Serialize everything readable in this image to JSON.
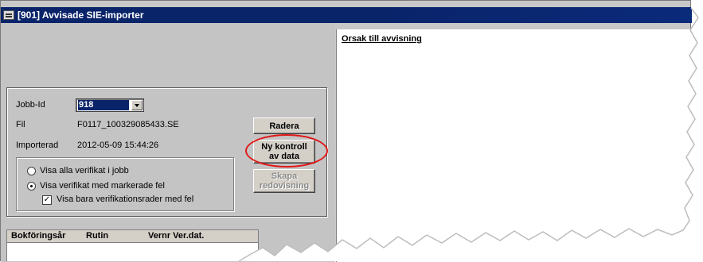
{
  "window": {
    "title": "[901]  Avvisade SIE-importer"
  },
  "form": {
    "jobb_id_label": "Jobb-Id",
    "jobb_id_value": "918",
    "fil_label": "Fil",
    "fil_value": "F0117_100329085433.SE",
    "importerad_label": "Importerad",
    "importerad_value": "2012-05-09 15:44:26"
  },
  "buttons": {
    "radera": "Radera",
    "ny_kontroll_line1": "Ny kontroll",
    "ny_kontroll_line2": "av data",
    "skapa_line1": "Skapa",
    "skapa_line2": "redovisning"
  },
  "filter": {
    "radio_all": "Visa alla verifikat i jobb",
    "radio_marked": "Visa verifikat med markerade fel",
    "checkbox_only_errors": "Visa bara verifikationsrader med fel",
    "selected": "radio_marked",
    "checkbox_checked": true
  },
  "grid": {
    "columns": [
      "Bokföringsår",
      "Rutin",
      "Vernr Ver.dat."
    ]
  },
  "reason": {
    "heading": "Orsak till avvisning"
  },
  "colors": {
    "titlebar": "#0a246a",
    "highlight_ring": "#e01818"
  }
}
